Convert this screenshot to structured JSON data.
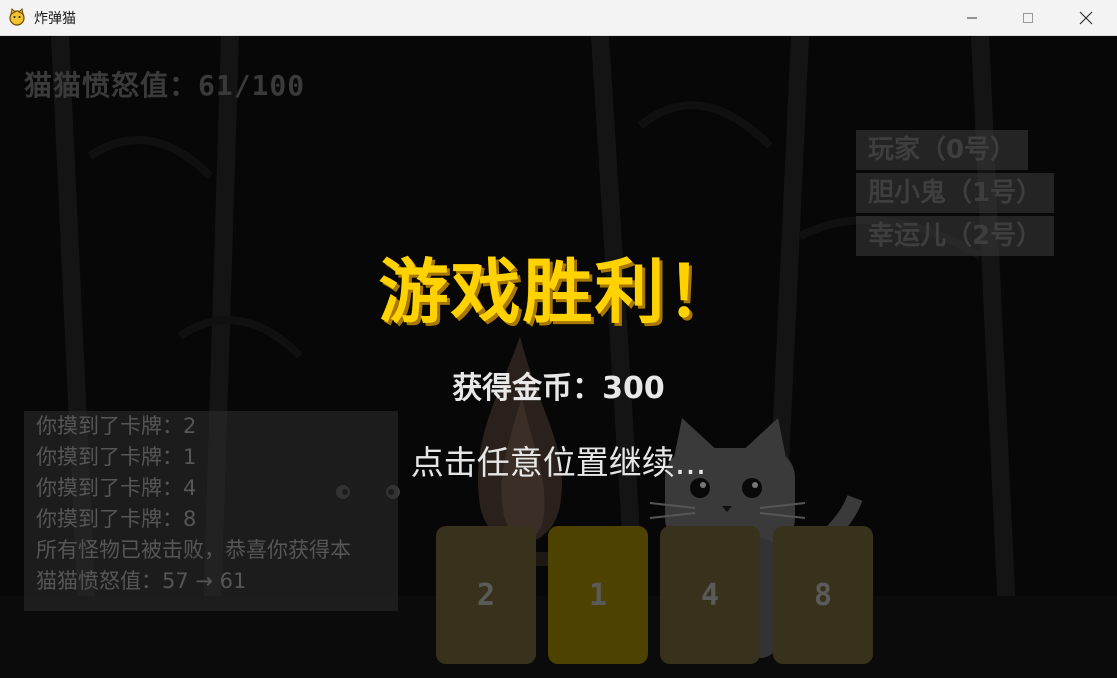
{
  "window": {
    "title": "炸弹猫",
    "icon": "cat-icon",
    "controls": [
      "minimize-icon",
      "maximize-icon",
      "close-icon"
    ]
  },
  "hud": {
    "rage_label": "猫猫愤怒值：61/100",
    "rage_value": 61,
    "rage_max": 100
  },
  "players": [
    {
      "label": "玩家（0号）"
    },
    {
      "label": "胆小鬼（1号）"
    },
    {
      "label": "幸运儿（2号）"
    }
  ],
  "result": {
    "title": "游戏胜利！",
    "coins": "获得金币：300",
    "prompt": "点击任意位置继续..."
  },
  "log": [
    "你摸到了卡牌：2",
    "你摸到了卡牌：1",
    "你摸到了卡牌：4",
    "你摸到了卡牌：8",
    "所有怪物已被击败，恭喜你获得本",
    "猫猫愤怒值：57 → 61"
  ],
  "cards": [
    {
      "value": "2",
      "selected": false
    },
    {
      "value": "1",
      "selected": true
    },
    {
      "value": "4",
      "selected": false
    },
    {
      "value": "8",
      "selected": false
    }
  ],
  "colors": {
    "victory": "#ffd200",
    "card": "#38321c",
    "card_selected": "#4d4200",
    "background": "#080808"
  }
}
